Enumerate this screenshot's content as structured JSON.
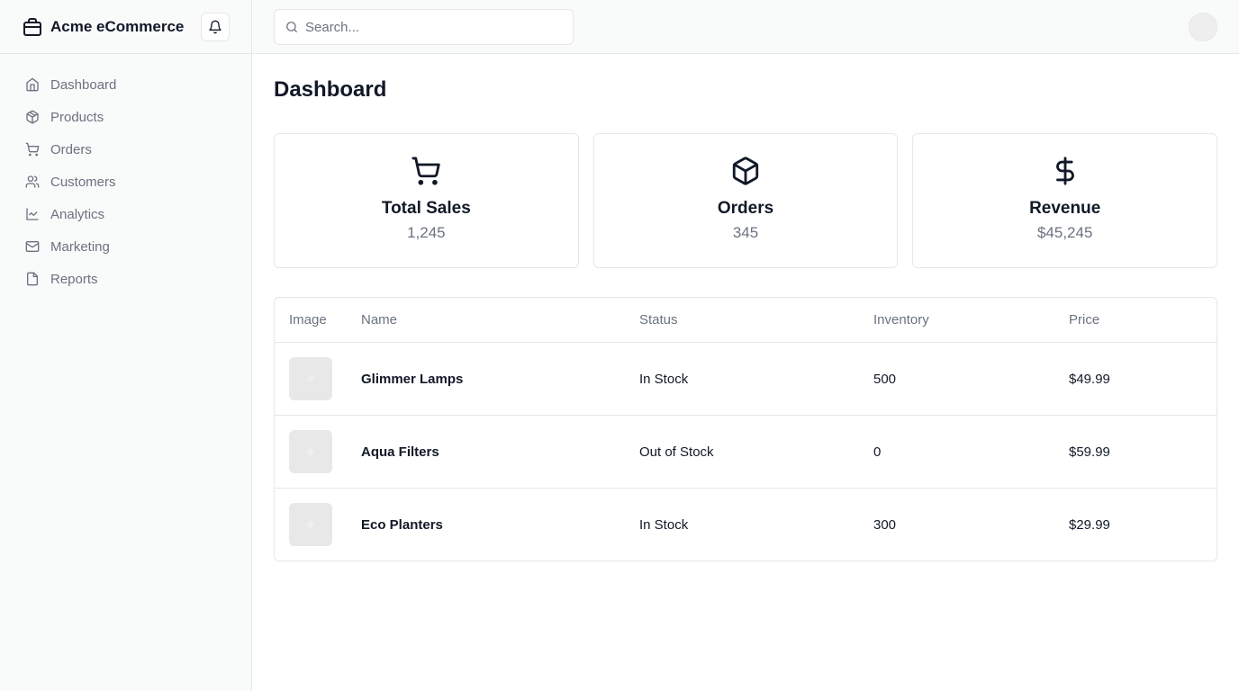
{
  "app": {
    "brand_name": "Acme eCommerce"
  },
  "sidebar": {
    "items": [
      {
        "label": "Dashboard",
        "icon": "home-icon"
      },
      {
        "label": "Products",
        "icon": "package-icon"
      },
      {
        "label": "Orders",
        "icon": "cart-icon"
      },
      {
        "label": "Customers",
        "icon": "users-icon"
      },
      {
        "label": "Analytics",
        "icon": "line-chart-icon"
      },
      {
        "label": "Marketing",
        "icon": "mail-icon"
      },
      {
        "label": "Reports",
        "icon": "file-icon"
      }
    ]
  },
  "header": {
    "search_placeholder": "Search...",
    "search_value": ""
  },
  "main": {
    "title": "Dashboard",
    "stats": [
      {
        "title": "Total Sales",
        "value": "1,245",
        "icon": "cart-icon"
      },
      {
        "title": "Orders",
        "value": "345",
        "icon": "package-icon"
      },
      {
        "title": "Revenue",
        "value": "$45,245",
        "icon": "dollar-icon"
      }
    ],
    "table": {
      "columns": [
        "Image",
        "Name",
        "Status",
        "Inventory",
        "Price"
      ],
      "rows": [
        {
          "name": "Glimmer Lamps",
          "status": "In Stock",
          "inventory": "500",
          "price": "$49.99"
        },
        {
          "name": "Aqua Filters",
          "status": "Out of Stock",
          "inventory": "0",
          "price": "$59.99"
        },
        {
          "name": "Eco Planters",
          "status": "In Stock",
          "inventory": "300",
          "price": "$29.99"
        }
      ]
    }
  },
  "colors": {
    "sidebar_bg": "#f9fafa",
    "border": "#e5e7eb",
    "text_primary": "#111827",
    "text_muted": "#6b7280"
  }
}
